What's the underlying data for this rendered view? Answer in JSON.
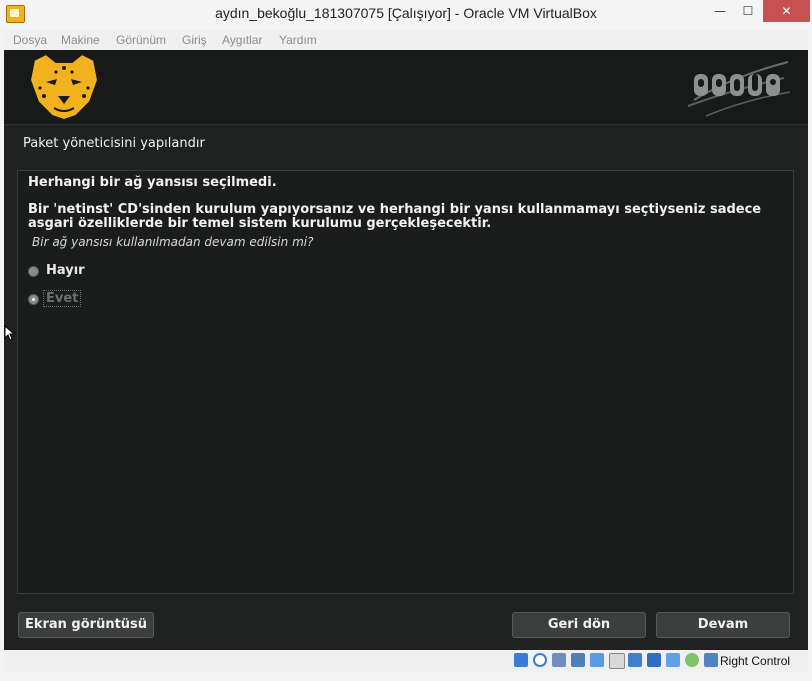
{
  "window": {
    "title": "aydın_bekoğlu_181307075 [Çalışıyor] - Oracle VM VirtualBox",
    "min_glyph": "—",
    "max_glyph": "☐",
    "close_glyph": "✕"
  },
  "menubar": {
    "items": [
      "Dosya",
      "Makine",
      "Görünüm",
      "Giriş",
      "Aygıtlar",
      "Yardım"
    ]
  },
  "installer": {
    "step_title": "Paket yöneticisini yapılandır",
    "message_main": "Herhangi bir ağ yansısı seçilmedi.",
    "message_paragraph": "Bir 'netinst' CD'sinden kurulum yapıyorsanız ve herhangi bir yansı kullanmamayı seçtiyseniz sadece asgari özelliklerde bir temel sistem kurulumu gerçekleşecektir.",
    "question": "Bir ağ yansısı kullanılmadan devam edilsin mi?",
    "options": [
      {
        "label": "Hayır",
        "selected": false
      },
      {
        "label": "Evet",
        "selected": true
      }
    ],
    "buttons": {
      "screenshot": "Ekran görüntüsü",
      "back": "Geri dön",
      "next": "Devam"
    }
  },
  "statusbar": {
    "host_key": "Right Control",
    "icons": [
      "hard-disk-icon",
      "optical-drive-icon",
      "audio-icon",
      "network-icon",
      "usb-icon",
      "shared-folders-icon",
      "display-icon",
      "video-capture-icon",
      "virtualization-icon",
      "mouse-integration-icon",
      "keyboard-capture-icon"
    ]
  },
  "colors": {
    "accent_yellow": "#f2b21d",
    "vm_background": "#1f2220",
    "close_button": "#c75050"
  }
}
